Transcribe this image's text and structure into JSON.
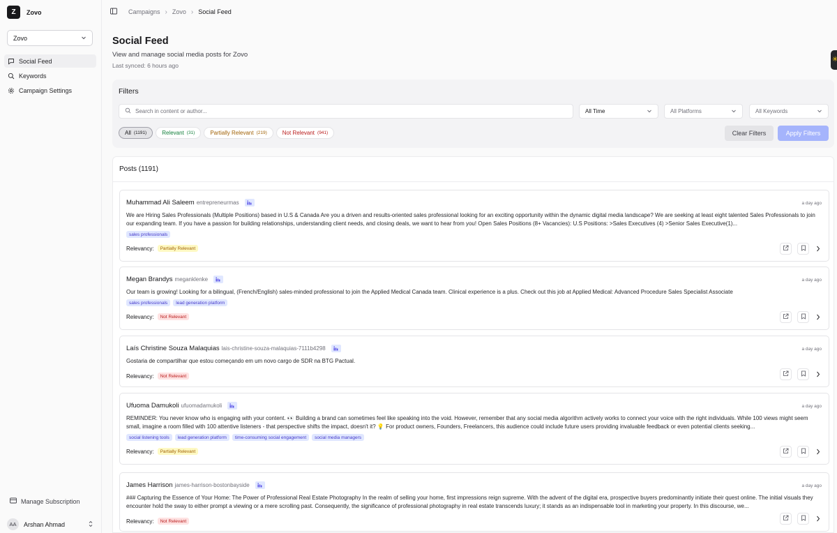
{
  "brand": {
    "logo_letter": "Z",
    "name": "Zovo"
  },
  "project_select": {
    "value": "Zovo"
  },
  "sidebar": {
    "items": [
      {
        "label": "Social Feed",
        "icon": "message-square-icon",
        "active": true
      },
      {
        "label": "Keywords",
        "icon": "search-icon",
        "active": false
      },
      {
        "label": "Campaign Settings",
        "icon": "gear-icon",
        "active": false
      }
    ],
    "manage_subscription": "Manage Subscription",
    "user": {
      "initials": "AA",
      "name": "Arshan Ahmad"
    }
  },
  "breadcrumb": {
    "items": [
      "Campaigns",
      "Zovo",
      "Social Feed"
    ]
  },
  "header": {
    "title": "Social Feed",
    "subtitle": "View and manage social media posts for Zovo",
    "last_synced": "Last synced: 6 hours ago"
  },
  "filters": {
    "title": "Filters",
    "search_placeholder": "Search in content or author...",
    "time": "All Time",
    "platforms": "All Platforms",
    "keywords": "All Keywords",
    "pills": [
      {
        "label": "All",
        "count": "(1191)",
        "color": "#18181b"
      },
      {
        "label": "Relevant",
        "count": "(31)",
        "color": "#15803d"
      },
      {
        "label": "Partially Relevant",
        "count": "(219)",
        "color": "#a16207"
      },
      {
        "label": "Not Relevant",
        "count": "(941)",
        "color": "#b91c1c"
      }
    ],
    "clear_label": "Clear Filters",
    "apply_label": "Apply Filters"
  },
  "posts": {
    "header": "Posts (1191)",
    "relevancy_label": "Relevancy:",
    "items": [
      {
        "author": "Muhammad Ali Saleem",
        "handle": "entrepreneurmas",
        "time": "a day ago",
        "content": "We are Hiring Sales Professionals (Multiple Positions) based in U.S & Canada Are you a driven and results-oriented sales professional looking for an exciting opportunity within the dynamic digital media landscape? We are seeking at least eight talented Sales Professionals to join our expanding team. If you have a passion for building relationships, understanding client needs, and closing deals, we want to hear from you! Open Sales Positions (8+ Vacancies): U.S Positions: >Sales Executives (4) >Senior Sales Executive(1)...",
        "tags": [
          "sales professionals"
        ],
        "relevancy": "Partially Relevant"
      },
      {
        "author": "Megan Brandys",
        "handle": "meganklenke",
        "time": "a day ago",
        "content": "Our team is growing! Looking for a bilingual, (French/English) sales-minded professional to join the Applied Medical Canada team. Clinical experience is a plus. Check out this job at Applied Medical: Advanced Procedure Sales Specialist Associate",
        "tags": [
          "sales professionals",
          "lead generation platform"
        ],
        "relevancy": "Not Relevant"
      },
      {
        "author": "Laís Christine Souza Malaquias",
        "handle": "lais-christine-souza-malaquias-7111b4298",
        "time": "a day ago",
        "content": "Gostaria de compartilhar que estou começando em um novo cargo de SDR na BTG Pactual.",
        "tags": [],
        "relevancy": "Not Relevant"
      },
      {
        "author": "Ufuoma Damukoli",
        "handle": "ufuomadamukoli",
        "time": "a day ago",
        "content": "REMINDER: You never know who is engaging with your content. 👀 Building a brand can sometimes feel like speaking into the void. However, remember that any social media algorithm actively works to connect your voice with the right individuals. While 100 views might seem small, imagine a room filled with 100 attentive listeners - that perspective shifts the impact, doesn't it? 💡 For product owners, Founders, Freelancers, this audience could include future users providing invaluable feedback or even potential clients seeking...",
        "tags": [
          "social listening tools",
          "lead generation platform",
          "time-consuming social engagement",
          "social media managers"
        ],
        "relevancy": "Partially Relevant"
      },
      {
        "author": "James Harrison",
        "handle": "james-harrison-bostonbayside",
        "time": "a day ago",
        "content": "### Capturing the Essence of Your Home: The Power of Professional Real Estate Photography In the realm of selling your home, first impressions reign supreme. With the advent of the digital era, prospective buyers predominantly initiate their quest online. The initial visuals they encounter hold the sway to either prompt a viewing or a mere scrolling past. Consequently, the significance of professional photography in real estate transcends luxury; it stands as an indispensable tool in marketing your property. In this discourse, we...",
        "tags": [],
        "relevancy": "Not Relevant"
      }
    ]
  }
}
